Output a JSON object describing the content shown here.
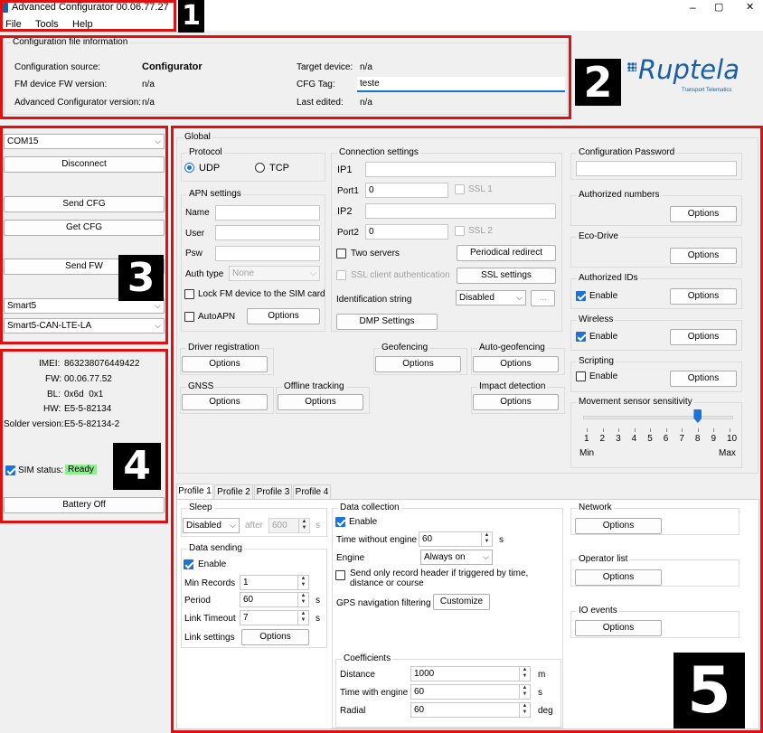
{
  "window": {
    "title": "Advanced Configurator 00.06.77.27",
    "min": "–",
    "max": "▢",
    "close": "✕"
  },
  "menu": [
    "File",
    "Tools",
    "Help"
  ],
  "badges": [
    "1",
    "2",
    "3",
    "4",
    "5"
  ],
  "config_info": {
    "group": "Configuration file information",
    "source_label": "Configuration source:",
    "source_value": "Configurator",
    "fw_label": "FM device FW version:",
    "fw_value": "n/a",
    "adv_label": "Advanced Configurator version:",
    "adv_value": "n/a",
    "target_label": "Target device:",
    "target_value": "n/a",
    "tag_label": "CFG Tag:",
    "tag_value": "teste",
    "edited_label": "Last edited:",
    "edited_value": "n/a"
  },
  "logo": {
    "brand": "Ruptela",
    "sub": "Transport Telematics",
    "accent": "#1a5ea8"
  },
  "connection": {
    "port": "COM15",
    "disconnect": "Disconnect",
    "send_cfg": "Send CFG",
    "get_cfg": "Get CFG",
    "send_fw": "Send FW",
    "device": "Smart5",
    "model": "Smart5-CAN-LTE-LA"
  },
  "device_info": {
    "imei_label": "IMEI:",
    "imei": "863238076449422",
    "fw_label": "FW:",
    "fw": "00.06.77.52",
    "bl_label": "BL:",
    "bl": "0x6d  0x1",
    "hw_label": "HW:",
    "hw": "E5-5-82134",
    "solder_label": "Solder version:",
    "solder": "E5-5-82134-2",
    "sim_label": "SIM status:",
    "sim_status": "Ready",
    "battery": "Battery Off"
  },
  "global": {
    "title": "Global",
    "protocol": {
      "label": "Protocol",
      "udp": "UDP",
      "tcp": "TCP"
    },
    "apn": {
      "label": "APN settings",
      "name": "Name",
      "user": "User",
      "psw": "Psw",
      "auth": "Auth type",
      "auth_value": "None",
      "lock": "Lock FM device to the SIM card",
      "autoapn": "AutoAPN",
      "options": "Options"
    },
    "conn": {
      "label": "Connection settings",
      "ip1": "IP1",
      "port1": "Port1",
      "port1_value": "0",
      "ssl1": "SSL 1",
      "ip2": "IP2",
      "port2": "Port2",
      "port2_value": "0",
      "ssl2": "SSL 2",
      "two_servers": "Two servers",
      "periodical": "Periodical redirect",
      "ssl_client": "SSL client authentication",
      "ssl_settings": "SSL settings",
      "id_string": "Identification string",
      "id_value": "Disabled",
      "dots": "...",
      "dmp": "DMP Settings"
    },
    "config_password": "Configuration Password",
    "auth_numbers": "Authorized numbers",
    "eco_drive": "Eco-Drive",
    "auth_ids": "Authorized IDs",
    "wireless": "Wireless",
    "scripting": "Scripting",
    "enable": "Enable",
    "options": "Options",
    "driver_reg": "Driver registration",
    "geofencing": "Geofencing",
    "auto_geofencing": "Auto-geofencing",
    "gnss": "GNSS",
    "offline": "Offline tracking",
    "impact": "Impact detection",
    "movement": {
      "label": "Movement sensor sensitivity",
      "ticks": [
        "1",
        "2",
        "3",
        "4",
        "5",
        "6",
        "7",
        "8",
        "9",
        "10"
      ],
      "min": "Min",
      "max": "Max",
      "value": 8
    }
  },
  "profiles": {
    "tabs": [
      "Profile 1",
      "Profile 2",
      "Profile 3",
      "Profile 4"
    ],
    "sleep": {
      "label": "Sleep",
      "value": "Disabled",
      "after": "after",
      "after_value": "600",
      "unit": "s"
    },
    "data_sending": {
      "label": "Data sending",
      "enable": "Enable",
      "min_records": "Min Records",
      "min_value": "1",
      "period": "Period",
      "period_value": "60",
      "link_timeout": "Link Timeout",
      "link_value": "7",
      "unit": "s",
      "link_settings": "Link settings",
      "options": "Options"
    },
    "data_collection": {
      "label": "Data collection",
      "enable": "Enable",
      "time_wo": "Time without engine",
      "time_wo_value": "60",
      "unit": "s",
      "engine": "Engine",
      "engine_value": "Always on",
      "send_header": "Send only record header if triggered by time,",
      "send_header2": "distance or course",
      "gps": "GPS navigation filtering",
      "customize": "Customize"
    },
    "coefficients": {
      "label": "Coefficients",
      "distance": "Distance",
      "distance_value": "1000",
      "distance_unit": "m",
      "time_engine": "Time with engine",
      "time_engine_value": "60",
      "time_unit": "s",
      "radial": "Radial",
      "radial_value": "60",
      "radial_unit": "deg"
    },
    "network": "Network",
    "operator": "Operator list",
    "io": "IO events",
    "options": "Options"
  }
}
